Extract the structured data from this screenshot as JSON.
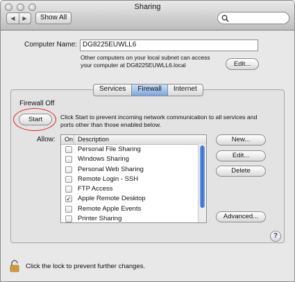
{
  "window": {
    "title": "Sharing"
  },
  "toolbar": {
    "back_glyph": "◀",
    "forward_glyph": "▶",
    "show_all_label": "Show All",
    "search_value": ""
  },
  "computer": {
    "name_label": "Computer Name:",
    "name_value": "DG8225EUWLL6",
    "info_line1": "Other computers on your local subnet can access",
    "info_line2": "your computer at DG8225EUWLL6.local",
    "edit_label": "Edit..."
  },
  "tabs": [
    {
      "label": "Services",
      "active": false
    },
    {
      "label": "Firewall",
      "active": true
    },
    {
      "label": "Internet",
      "active": false
    }
  ],
  "firewall": {
    "status": "Firewall Off",
    "start_label": "Start",
    "start_desc_line1": "Click Start to prevent incoming network communication to all services and",
    "start_desc_line2": "ports other than those enabled below.",
    "allow_label": "Allow:",
    "col_on": "On",
    "col_description": "Description",
    "items": [
      {
        "label": "Personal File Sharing",
        "checked": false
      },
      {
        "label": "Windows Sharing",
        "checked": false
      },
      {
        "label": "Personal Web Sharing",
        "checked": false
      },
      {
        "label": "Remote Login - SSH",
        "checked": false
      },
      {
        "label": "FTP Access",
        "checked": false
      },
      {
        "label": "Apple Remote Desktop",
        "checked": true
      },
      {
        "label": "Remote Apple Events",
        "checked": false
      },
      {
        "label": "Printer Sharing",
        "checked": false
      }
    ],
    "check_glyph": "✓",
    "new_label": "New...",
    "edit_label": "Edit...",
    "delete_label": "Delete",
    "advanced_label": "Advanced...",
    "help_glyph": "?"
  },
  "footer": {
    "lock_text": "Click the lock to prevent further changes."
  },
  "colors": {
    "accent": "#3f7bd6",
    "highlight_circle": "#dd2222"
  }
}
